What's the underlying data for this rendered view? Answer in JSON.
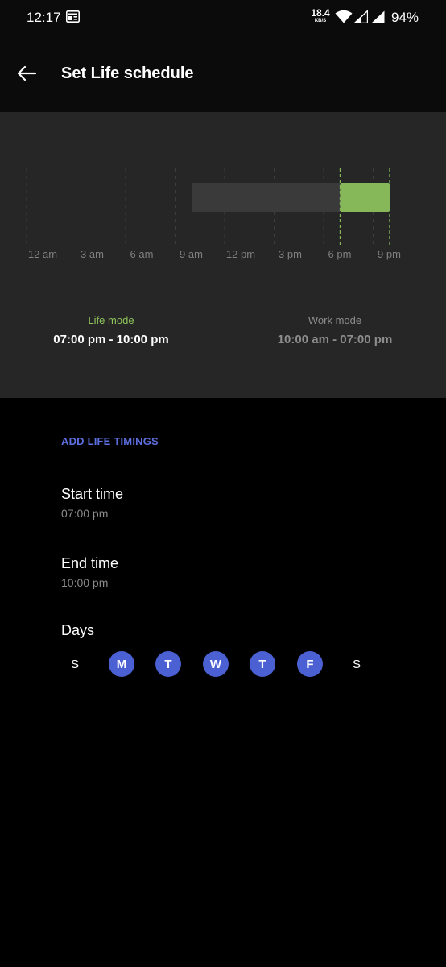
{
  "status_bar": {
    "time": "12:17",
    "net_speed": "18.4",
    "net_speed_unit": "KB/S",
    "battery": "94%",
    "icons": [
      "notification-icon",
      "wifi-icon",
      "signal-icon",
      "signal-icon",
      "battery-text"
    ]
  },
  "app_bar": {
    "title": "Set Life schedule",
    "back_icon": "arrow-left-icon"
  },
  "chart_data": {
    "type": "bar",
    "orientation": "horizontal-timeline",
    "x_ticks": [
      "12 am",
      "3 am",
      "6 am",
      "9 am",
      "12 pm",
      "3 pm",
      "6 pm",
      "9 pm"
    ],
    "x_range_hours": [
      0,
      24
    ],
    "series": [
      {
        "name": "Work mode",
        "start_hour": 10,
        "end_hour": 19,
        "color": "#3a3a3a"
      },
      {
        "name": "Life mode",
        "start_hour": 19,
        "end_hour": 22,
        "color": "#86b85a"
      }
    ],
    "grid": true,
    "markers_hours": [
      19,
      22
    ]
  },
  "modes": {
    "life": {
      "label": "Life mode",
      "range": "07:00 pm - 10:00 pm",
      "color": "#8fc45a"
    },
    "work": {
      "label": "Work mode",
      "range": "10:00 am - 07:00 pm",
      "color": "#8d8d8d"
    }
  },
  "settings": {
    "section_header": "ADD LIFE TIMINGS",
    "start_time": {
      "title": "Start time",
      "value": "07:00 pm"
    },
    "end_time": {
      "title": "End time",
      "value": "10:00 pm"
    },
    "days_title": "Days",
    "days": [
      {
        "label": "S",
        "selected": false
      },
      {
        "label": "M",
        "selected": true
      },
      {
        "label": "T",
        "selected": true
      },
      {
        "label": "W",
        "selected": true
      },
      {
        "label": "T",
        "selected": true
      },
      {
        "label": "F",
        "selected": true
      },
      {
        "label": "S",
        "selected": false
      }
    ]
  },
  "colors": {
    "accent": "#4a60d3",
    "section_header": "#5d6fe0",
    "life_green": "#86b85a"
  }
}
